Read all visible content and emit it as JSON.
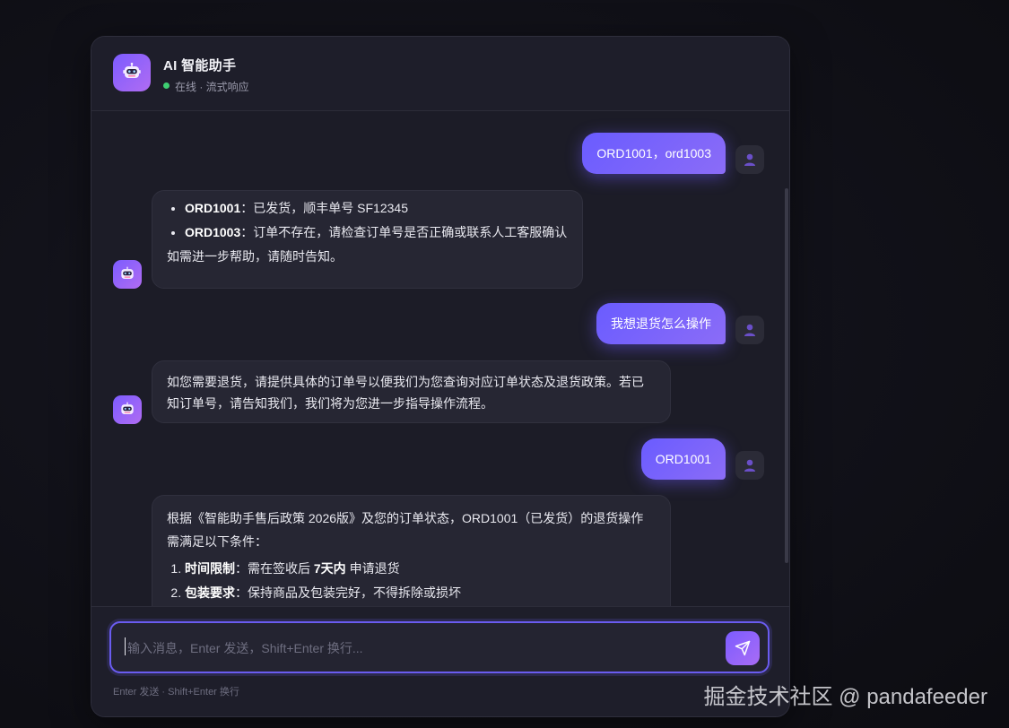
{
  "header": {
    "title": "AI 智能助手",
    "status": "在线 · 流式响应",
    "status_color": "#3ecf72",
    "avatar_icon": "robot-icon"
  },
  "messages": [
    {
      "role": "user",
      "text": "ORD1001，ord1003"
    },
    {
      "role": "assistant",
      "items": [
        {
          "bold": "ORD1001",
          "text": "：已发货，顺丰单号 SF12345"
        },
        {
          "bold": "ORD1003",
          "text": "：订单不存在，请检查订单号是否正确或联系人工客服确认"
        }
      ],
      "footer": "如需进一步帮助，请随时告知。"
    },
    {
      "role": "user",
      "text": "我想退货怎么操作"
    },
    {
      "role": "assistant",
      "text": "如您需要退货，请提供具体的订单号以便我们为您查询对应订单状态及退货政策。若已知订单号，请告知我们，我们将为您进一步指导操作流程。"
    },
    {
      "role": "user",
      "text": "ORD1001"
    },
    {
      "role": "assistant",
      "intro": "根据《智能助手售后政策 2026版》及您的订单状态，ORD1001（已发货）的退货操作需满足以下条件：",
      "items": [
        {
          "bold": "时间限制",
          "text": "：需在签收后 ",
          "bold2": "7天内",
          "text2": " 申请退货"
        },
        {
          "bold": "包装要求",
          "text": "：保持商品及包装完好，不得拆除或损坏"
        }
      ]
    }
  ],
  "input": {
    "placeholder": "输入消息，Enter 发送，Shift+Enter 换行...",
    "value": "",
    "hint": "Enter 发送 · Shift+Enter 换行",
    "send_icon": "send-icon"
  },
  "watermark": "掘金技术社区 @ pandafeeder",
  "colors": {
    "accent": "#6a5cff",
    "accent_2": "#a86cf5",
    "background": "#1c1c27",
    "bubble_bot": "#262633"
  }
}
